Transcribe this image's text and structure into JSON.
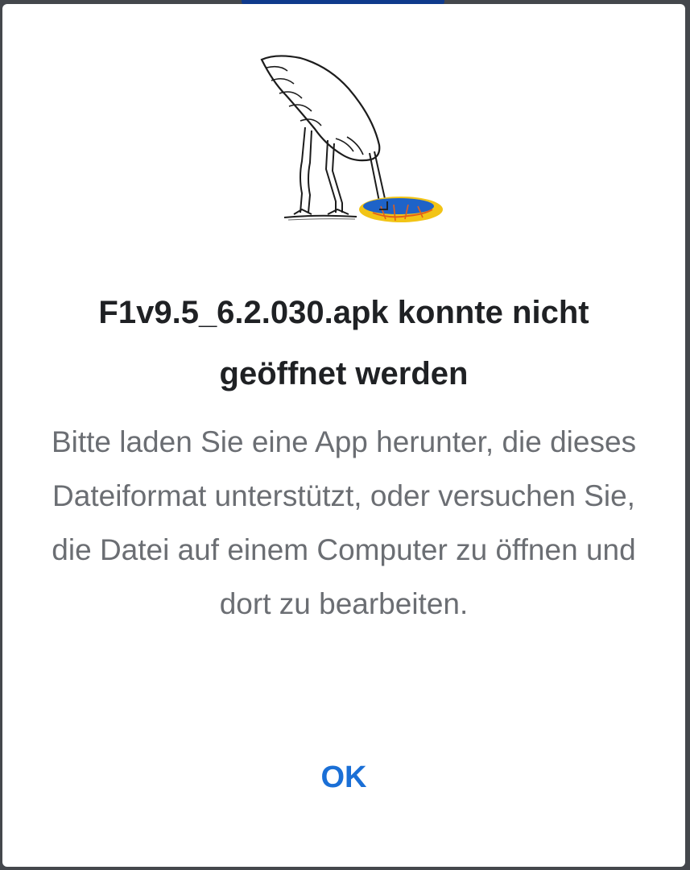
{
  "dialog": {
    "title": "F1v9.5_6.2.030.apk konnte nicht geöffnet werden",
    "message": "Bitte laden Sie eine App herunter, die dieses Dateiformat unterstützt, oder versuchen Sie, die Datei auf einem Computer zu öffnen und dort zu bearbeiten.",
    "ok_label": "OK",
    "illustration": "ostrich-head-in-hole-illustration"
  },
  "colors": {
    "title": "#1f2124",
    "message": "#6b6e73",
    "accent": "#1a6fd6",
    "dialog_background": "#ffffff"
  }
}
